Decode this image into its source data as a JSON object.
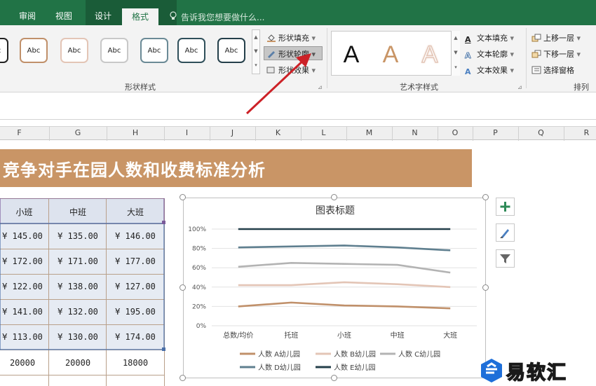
{
  "ribbon_tabs": [
    "审阅",
    "视图",
    "设计",
    "格式"
  ],
  "active_tab": "格式",
  "tellme": "告诉我您想要做什么...",
  "shape_styles": {
    "group_label": "形状样式",
    "swatch_text": "Abc",
    "fill_label": "形状填充",
    "outline_label": "形状轮廓",
    "effect_label": "形状效果"
  },
  "wordart": {
    "group_label": "艺术字样式",
    "letter": "A",
    "text_fill": "文本填充",
    "text_outline": "文本轮廓",
    "text_effect": "文本效果"
  },
  "arrange": {
    "group_label": "排列",
    "bring_forward": "上移一层",
    "send_backward": "下移一层",
    "selection_pane": "选择窗格"
  },
  "columns": [
    "F",
    "G",
    "H",
    "I",
    "J",
    "K",
    "L",
    "M",
    "N",
    "O",
    "P",
    "Q",
    "R"
  ],
  "sheet": {
    "banner_title": "竞争对手在园人数和收费标准分析",
    "headers": [
      "小班",
      "中班",
      "大班"
    ],
    "rows": [
      [
        "¥ 145.00",
        "¥ 135.00",
        "¥ 146.00"
      ],
      [
        "¥ 172.00",
        "¥ 171.00",
        "¥ 177.00"
      ],
      [
        "¥ 122.00",
        "¥ 138.00",
        "¥ 127.00"
      ],
      [
        "¥ 141.00",
        "¥ 132.00",
        "¥ 195.00"
      ],
      [
        "¥ 113.00",
        "¥ 130.00",
        "¥ 174.00"
      ],
      [
        "20000",
        "20000",
        "18000"
      ]
    ]
  },
  "chart_data": {
    "type": "line",
    "title": "图表标题",
    "categories": [
      "总数/均价",
      "托班",
      "小班",
      "中班",
      "大班"
    ],
    "ylim": [
      0,
      1
    ],
    "yticks": [
      "0%",
      "20%",
      "40%",
      "60%",
      "80%",
      "100%"
    ],
    "grid": true,
    "legend_placement": "bottom",
    "series": [
      {
        "name": "人数 A幼儿园",
        "color": "#c0906a",
        "values": [
          0.2,
          0.24,
          0.21,
          0.2,
          0.18
        ]
      },
      {
        "name": "人数 B幼儿园",
        "color": "#e3c5b6",
        "values": [
          0.42,
          0.42,
          0.45,
          0.43,
          0.4
        ]
      },
      {
        "name": "人数 C幼儿园",
        "color": "#b3b3b3",
        "values": [
          0.61,
          0.65,
          0.64,
          0.63,
          0.55
        ]
      },
      {
        "name": "人数 D幼儿园",
        "color": "#5f7f8f",
        "values": [
          0.81,
          0.82,
          0.83,
          0.81,
          0.78
        ]
      },
      {
        "name": "人数 E幼儿园",
        "color": "#243f4a",
        "values": [
          1.0,
          1.0,
          1.0,
          1.0,
          1.0
        ]
      }
    ]
  },
  "watermark": "易软汇",
  "colors": {
    "excel_green": "#217346",
    "banner": "#c99566",
    "arrow": "#cc2127"
  }
}
